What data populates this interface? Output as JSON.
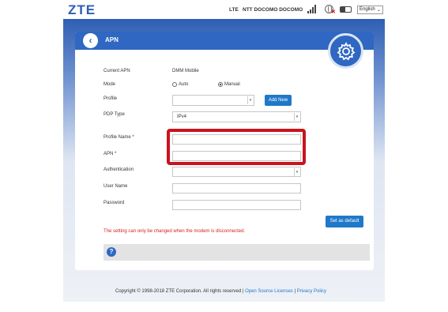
{
  "header": {
    "logo": "ZTE",
    "network_type": "LTE",
    "carrier": "NTT DOCOMO DOCOMO",
    "language": "English"
  },
  "panel": {
    "title": "APN",
    "back_icon": "chevron-left-icon",
    "settings_icon": "gear-icon"
  },
  "form": {
    "current_apn_label": "Current APN",
    "current_apn_value": "DMM Mobile",
    "mode_label": "Mode",
    "mode_options": [
      "Auto",
      "Manual"
    ],
    "mode_selected": "Manual",
    "profile_label": "Profile",
    "profile_value": "",
    "add_new_label": "Add New",
    "pdp_type_label": "PDP Type",
    "pdp_type_value": "IPv4",
    "profile_name_label": "Profile Name *",
    "profile_name_value": "",
    "apn_label": "APN *",
    "apn_value": "",
    "authentication_label": "Authentication",
    "authentication_value": "",
    "user_name_label": "User Name",
    "user_name_value": "",
    "password_label": "Password",
    "password_value": "",
    "set_default_label": "Set as default",
    "warning": "The setting can only be changed when the modem is disconnected."
  },
  "footer": {
    "copyright": "Copyright © 1998-2018 ZTE Corporation. All rights reserved",
    "separator": "|",
    "open_source_label": "Open Source Licenses",
    "privacy_label": "Privacy Policy"
  },
  "colors": {
    "brand_blue": "#2f67c2",
    "button_blue": "#1f78c8",
    "highlight_red": "#c8141e",
    "warning_red": "#d51f1f"
  }
}
